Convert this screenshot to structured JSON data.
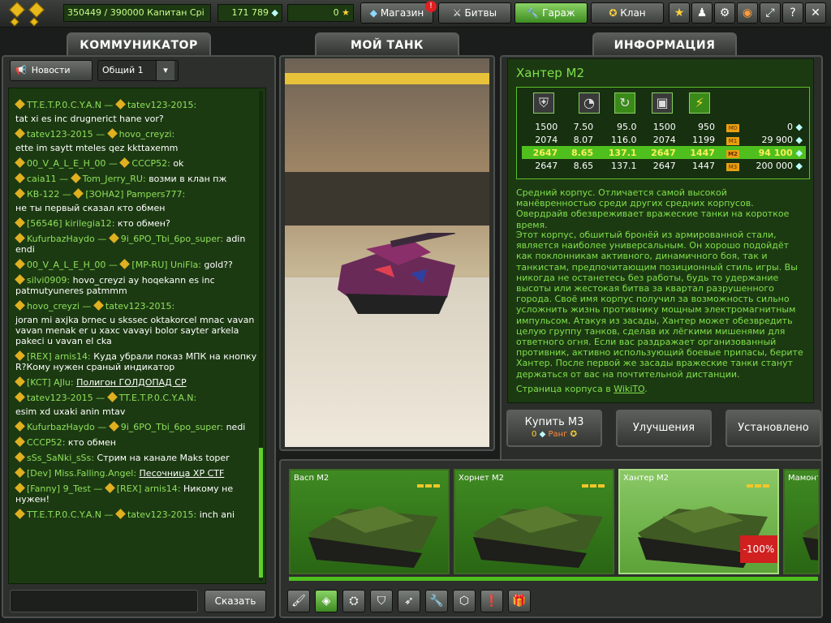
{
  "top": {
    "rank_text": "350449 / 390000  Капитан Срі",
    "crystals": "171 789",
    "stars": "0",
    "shop": "Магазин",
    "shop_badge": "!",
    "battles": "Битвы",
    "garage": "Гараж",
    "clan": "Клан"
  },
  "panels": {
    "communicator": "КОММУНИКАТОР",
    "my_tank": "МОЙ ТАНК",
    "info": "ИНФОРМАЦИЯ"
  },
  "chat": {
    "news_btn": "Новости",
    "channel": "Общий 1",
    "send_btn": "Сказать",
    "input_value": "",
    "messages": [
      {
        "from": "TT.E.T.P.0.C.Y.A.N",
        "to": "tatev123-2015",
        "text": "tat xi es inc drugnerict hane vor?"
      },
      {
        "from": "tatev123-2015",
        "to": "hovo_creyzi",
        "text": "ette im saytt mteles qez kkttaxemm"
      },
      {
        "from": "00_V_A_L_E_H_00",
        "to": "CCCP52",
        "text": "ok"
      },
      {
        "from": "caia11",
        "to": "Tom_Jerry_RU",
        "text": "возми в клан пж"
      },
      {
        "from": "КВ-122",
        "to": "[ЗОНА2] Pampers777",
        "text": "не ты первый сказал кто обмен"
      },
      {
        "from": "[56546] kirilegia12",
        "to": "",
        "text": "кто обмен?"
      },
      {
        "from": "KufurbazHaydo",
        "to": "9i_6PO_Tbi_6po_super",
        "text": "adin endi"
      },
      {
        "from": "00_V_A_L_E_H_00",
        "to": "[MP-RU] UniFla",
        "text": "gold??"
      },
      {
        "from": "silvi0909",
        "to": "",
        "text": "hovo_creyzi ay hoqekann es inc patmutyuneres patmmm"
      },
      {
        "from": "hovo_creyzi",
        "to": "tatev123-2015",
        "text": "joran mi axjka brnec u skssec oktakorcel mnac vavan vavan menak er u xaxc vavayi bolor sayter arkela pakeci u vavan el cka"
      },
      {
        "from": "[REX] arnis14",
        "to": "",
        "text": "Куда убрали показ МПК на кнопку R?Кому нужен сраный индикатор"
      },
      {
        "from": "[KCT] AJlu",
        "to": "",
        "text": "Полигон ГОЛДОПАД СР"
      },
      {
        "from": "tatev123-2015",
        "to": "TT.E.T.P.0.C.Y.A.N",
        "text": "esim xd uxaki anin mtav"
      },
      {
        "from": "KufurbazHaydo",
        "to": "9i_6PO_Tbi_6po_super",
        "text": "nedi"
      },
      {
        "from": "CCCP52",
        "to": "",
        "text": "кто обмен"
      },
      {
        "from": "sSs_SaNki_sSs",
        "to": "",
        "text": "Стрим на канале Maks toper"
      },
      {
        "from": "[Dev] Miss.Falling.Angel",
        "to": "",
        "text": "Песочница XP CTF"
      },
      {
        "from": "[Fanny] 9_Test",
        "to": "[REX] arnis14",
        "text": "Никому не нужен!"
      },
      {
        "from": "TT.E.T.P.0.C.Y.A.N",
        "to": "tatev123-2015",
        "text": "inch ani"
      }
    ]
  },
  "info": {
    "title": "Хантер M2",
    "stats": [
      {
        "v": [
          "1500",
          "7.50",
          "95.0",
          "1500",
          "950"
        ],
        "mk": "M0",
        "price": "0"
      },
      {
        "v": [
          "2074",
          "8.07",
          "116.0",
          "2074",
          "1199"
        ],
        "mk": "M1",
        "price": "29 900"
      },
      {
        "v": [
          "2647",
          "8.65",
          "137.1",
          "2647",
          "1447"
        ],
        "mk": "M2",
        "price": "94 100"
      },
      {
        "v": [
          "2647",
          "8.65",
          "137.1",
          "2647",
          "1447"
        ],
        "mk": "M3",
        "price": "200 000"
      }
    ],
    "desc1": "Средний корпус. Отличается самой высокой манёвренностью среди других средних корпусов. Овердрайв обезвреживает вражеские танки на короткое время.",
    "desc2": "Этот корпус, обшитый бронёй из армированной стали, является наиболее универсальным. Он хорошо подойдёт как поклонникам активного, динамичного боя, так и танкистам, предпочитающим позиционный стиль игры. Вы никогда не останетесь без работы, будь то удержание высоты или жестокая битва за квартал разрушенного города. Своё имя корпус получил за возможность сильно усложнить жизнь противнику мощным электромагнитным импульсом. Атакуя из засады, Хантер может обезвредить целую группу танков, сделав их лёгкими мишенями для ответного огня. Если вас раздражает организованный противник, активно использующий боевые припасы, берите Хантер. После первой же засады вражеские танки станут держаться от вас на почтительной дистанции.",
    "wiki_prefix": "Страница корпуса в",
    "wiki_link": "WikiTO",
    "wiki_suffix": "."
  },
  "buttons": {
    "buy": "Купить M3",
    "buy_price": "0",
    "buy_rank": "Ранг",
    "upgrade": "Улучшения",
    "installed": "Установлено"
  },
  "cards": [
    {
      "name": "Васп M2"
    },
    {
      "name": "Хорнет M2"
    },
    {
      "name": "Хантер M2",
      "badge": "-100%"
    },
    {
      "name": "Мамонт"
    }
  ],
  "colors": {
    "accent_green": "#4fbf1e",
    "chat_bg": "#1c3a12",
    "text_green": "#7fe04a"
  }
}
